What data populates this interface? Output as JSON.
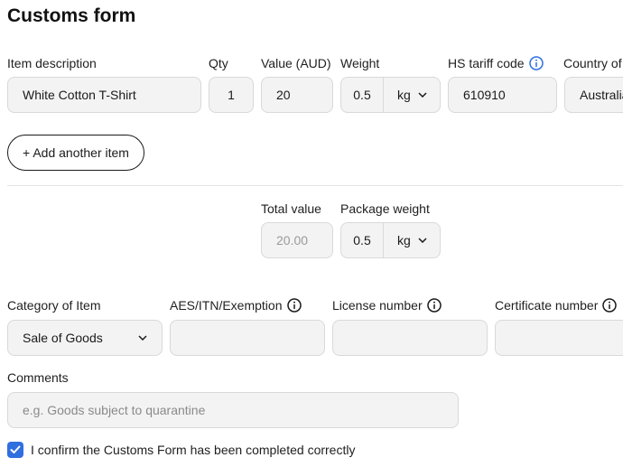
{
  "page": {
    "title": "Customs form"
  },
  "item": {
    "description_label": "Item description",
    "description_value": "White Cotton T-Shirt",
    "qty_label": "Qty",
    "qty_value": "1",
    "value_label": "Value (AUD)",
    "value_value": "20",
    "weight_label": "Weight",
    "weight_value": "0.5",
    "weight_unit": "kg",
    "hs_label": "HS tariff code",
    "hs_value": "610910",
    "country_label": "Country of",
    "country_value": "Australia"
  },
  "add_item_label": "+ Add another item",
  "totals": {
    "total_value_label": "Total value",
    "total_value": "20.00",
    "package_weight_label": "Package weight",
    "package_weight_value": "0.5",
    "package_weight_unit": "kg"
  },
  "details": {
    "category_label": "Category of Item",
    "category_value": "Sale of Goods",
    "aes_label": "AES/ITN/Exemption",
    "aes_value": "",
    "license_label": "License number",
    "license_value": "",
    "certificate_label": "Certificate number",
    "certificate_value": ""
  },
  "comments": {
    "label": "Comments",
    "placeholder": "e.g. Goods subject to quarantine"
  },
  "confirm": {
    "label": "I confirm the Customs Form has been completed correctly",
    "checked": true
  },
  "colors": {
    "accent": "#2f6fe0",
    "info_blue": "#2f6fe0"
  },
  "icons": [
    "info-icon",
    "chevron-down-icon",
    "checkmark-icon"
  ]
}
